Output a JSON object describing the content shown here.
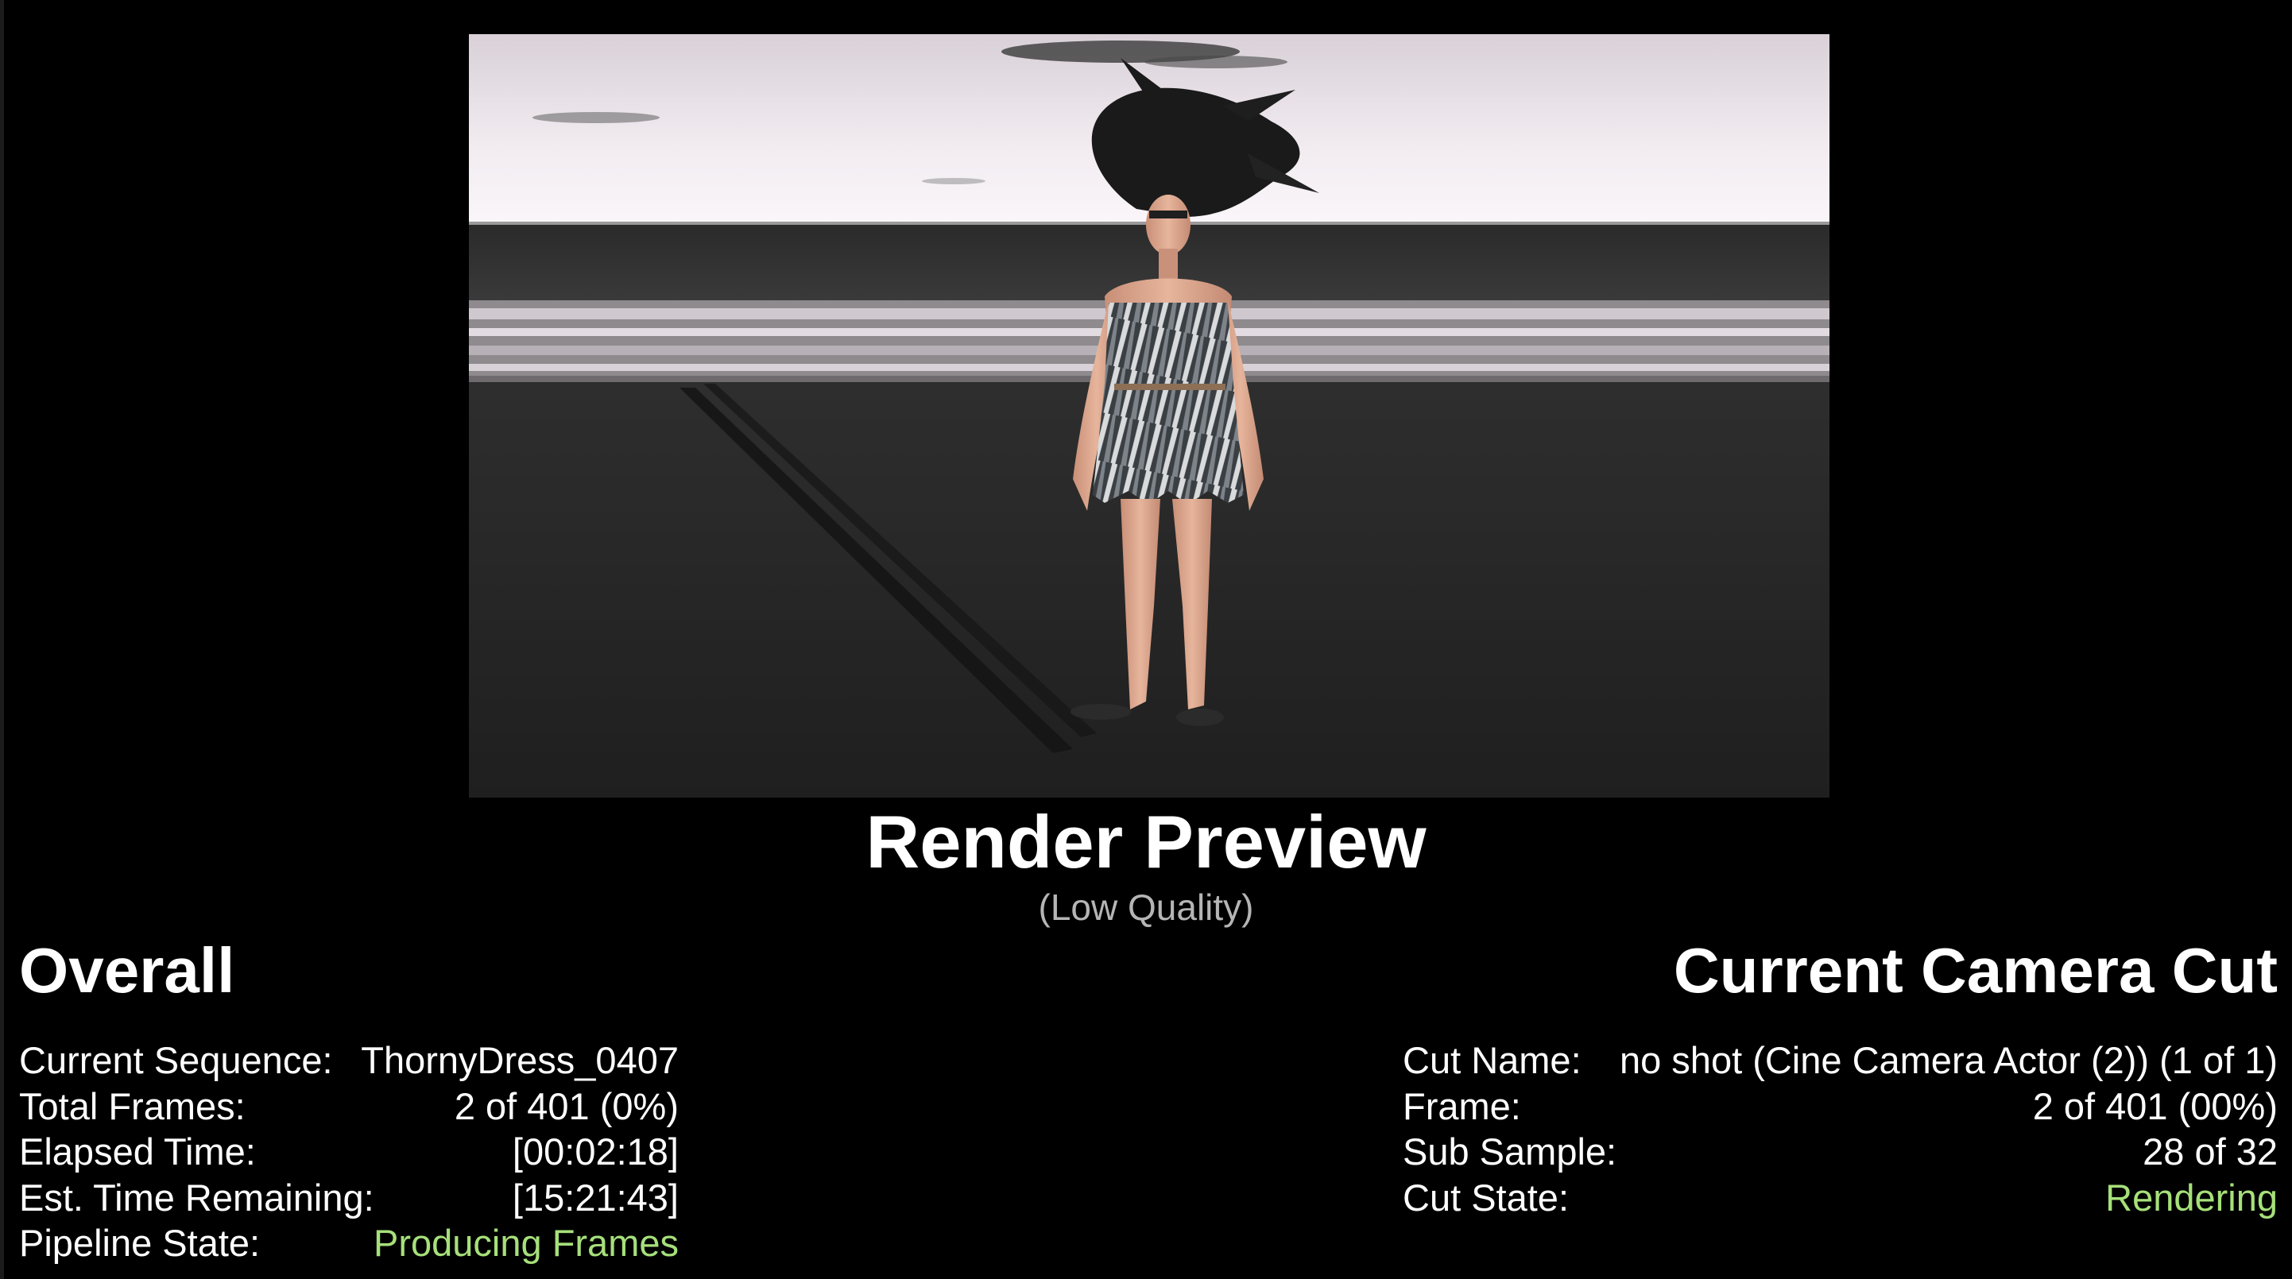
{
  "preview": {
    "title": "Render Preview",
    "subtitle": "(Low Quality)"
  },
  "overall": {
    "heading": "Overall",
    "rows": [
      {
        "label": "Current Sequence:",
        "value": "ThornyDress_0407"
      },
      {
        "label": "Total Frames:",
        "value": "2 of 401 (0%)"
      },
      {
        "label": "Elapsed Time:",
        "value": "[00:02:18]"
      },
      {
        "label": "Est. Time Remaining:",
        "value": "[15:21:43]"
      },
      {
        "label": "Pipeline State:",
        "value": "Producing Frames"
      }
    ]
  },
  "camera_cut": {
    "heading": "Current Camera Cut",
    "rows": [
      {
        "label": "Cut Name:",
        "value": "no shot (Cine Camera Actor (2)) (1 of 1)"
      },
      {
        "label": "Frame:",
        "value": "2 of 401 (00%)"
      },
      {
        "label": "Sub Sample:",
        "value": "28 of 32"
      },
      {
        "label": "Cut State:",
        "value": "Rendering"
      }
    ]
  },
  "colors": {
    "background": "#000000",
    "text": "#ffffff",
    "subtitle": "#b5b5b5",
    "status_active": "#a6e07a"
  }
}
